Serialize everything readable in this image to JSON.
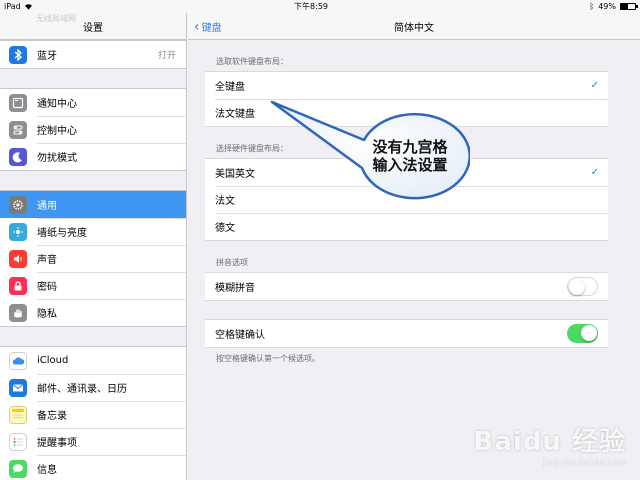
{
  "statusbar": {
    "device": "iPad",
    "time": "下午8:59",
    "battery": "49%",
    "battery_level": 0.49
  },
  "left": {
    "title": "设置",
    "ghost": "无线局域网",
    "bluetooth": {
      "label": "蓝牙",
      "value": "打开",
      "color": "#1f7ae0"
    },
    "group2": [
      {
        "label": "通知中心",
        "icon": "notification-center-icon",
        "color": "#8e8e93"
      },
      {
        "label": "控制中心",
        "icon": "control-center-icon",
        "color": "#8e8e93"
      },
      {
        "label": "勿扰模式",
        "icon": "moon-icon",
        "color": "#5856d6"
      }
    ],
    "group3": [
      {
        "label": "通用",
        "icon": "gear-icon",
        "color": "#8e8e93",
        "selected": true
      },
      {
        "label": "墙纸与亮度",
        "icon": "wallpaper-icon",
        "color": "#34aadc"
      },
      {
        "label": "声音",
        "icon": "speaker-icon",
        "color": "#ff3b30"
      },
      {
        "label": "密码",
        "icon": "lock-icon",
        "color": "#ff2d55"
      },
      {
        "label": "隐私",
        "icon": "hand-icon",
        "color": "#8e8e93"
      }
    ],
    "group4": [
      {
        "label": "iCloud",
        "icon": "cloud-icon",
        "color": "#3b8fe9"
      },
      {
        "label": "邮件、通讯录、日历",
        "icon": "mail-icon",
        "color": "#1f7ae0"
      },
      {
        "label": "备忘录",
        "icon": "notes-icon",
        "color": "#ffcc00"
      },
      {
        "label": "提醒事项",
        "icon": "reminders-icon",
        "color": "#ffffff"
      },
      {
        "label": "信息",
        "icon": "messages-icon",
        "color": "#4cd964"
      }
    ]
  },
  "right": {
    "back_label": "键盘",
    "title": "简体中文",
    "soft_section": "选取软件键盘布局：",
    "soft_rows": [
      {
        "label": "全键盘",
        "checked": true
      },
      {
        "label": "法文键盘",
        "checked": false
      }
    ],
    "hard_section": "选择硬件键盘布局：",
    "hard_rows": [
      {
        "label": "美国英文",
        "checked": true
      },
      {
        "label": "法文",
        "checked": false
      },
      {
        "label": "德文",
        "checked": false
      }
    ],
    "pinyin_section": "拼音选项",
    "fuzzy": {
      "label": "模糊拼音",
      "on": false
    },
    "space": {
      "label": "空格键确认",
      "on": true
    },
    "space_note": "按空格键确认第一个候选项。"
  },
  "callout": {
    "line1": "没有九宫格",
    "line2": "输入法设置"
  },
  "watermark": {
    "brand": "Baidu 经验",
    "url": "jingyan.baidu.com"
  },
  "colors": {
    "accent": "#2a7fe0",
    "selected_row": "#3f96f1",
    "toggle_on": "#4cd964"
  }
}
